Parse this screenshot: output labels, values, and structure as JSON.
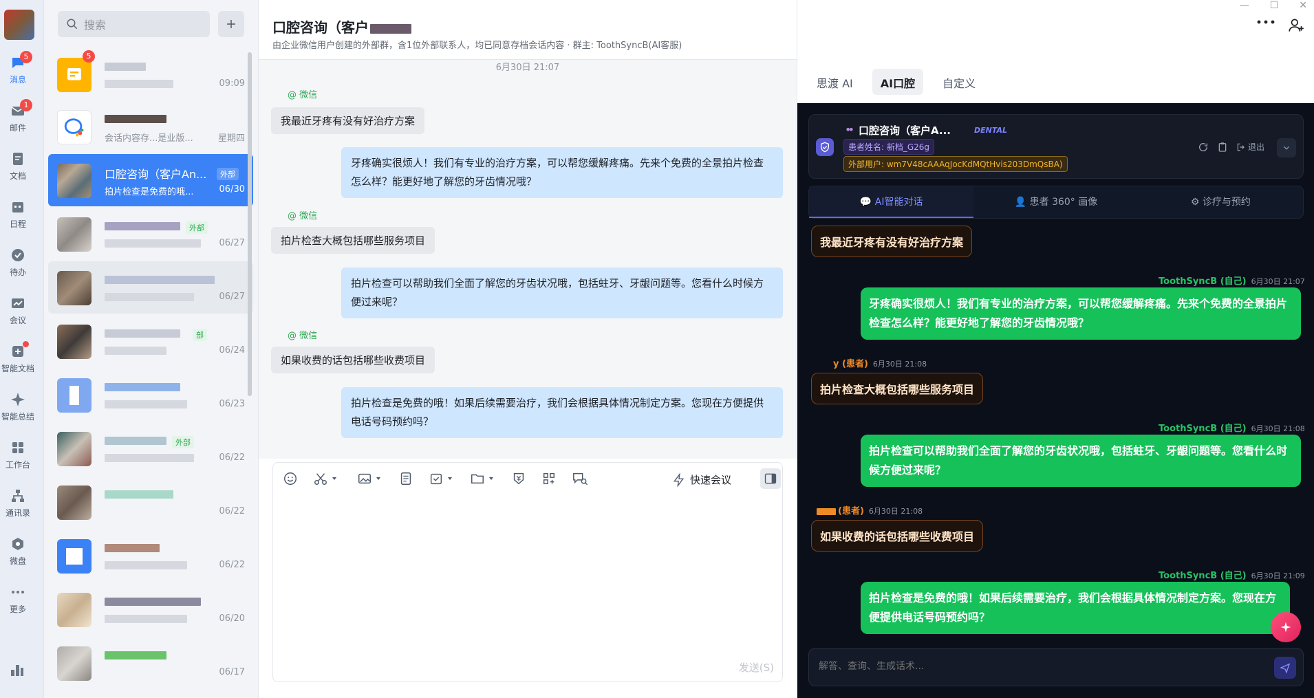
{
  "nav": {
    "items": [
      {
        "label": "消息",
        "icon": "chat-bubble-icon",
        "badge": "5"
      },
      {
        "label": "邮件",
        "icon": "mail-icon",
        "badge": "1"
      },
      {
        "label": "文档",
        "icon": "document-icon"
      },
      {
        "label": "日程",
        "icon": "calendar-icon"
      },
      {
        "label": "待办",
        "icon": "checkmark-icon"
      },
      {
        "label": "会议",
        "icon": "meeting-icon"
      },
      {
        "label": "智能文档",
        "icon": "smart-doc-icon",
        "dot": true
      },
      {
        "label": "智能总结",
        "icon": "sparkle-icon"
      },
      {
        "label": "工作台",
        "icon": "grid-icon"
      },
      {
        "label": "通讯录",
        "icon": "org-chart-icon"
      },
      {
        "label": "微盘",
        "icon": "cloud-drive-icon"
      },
      {
        "label": "更多",
        "icon": "more-dots-icon"
      }
    ]
  },
  "list": {
    "search_placeholder": "搜索",
    "chats": [
      {
        "name": "",
        "preview": "",
        "time": "09:09",
        "badge": "5"
      },
      {
        "name": "",
        "preview": "会话内容存...是业版...",
        "time": "星期四"
      },
      {
        "name": "口腔咨询（客户An...",
        "preview": "拍片检查是免费的哦...",
        "time": "06/30",
        "tag": "外部",
        "active": true
      },
      {
        "name": "",
        "preview": "",
        "time": "06/27",
        "tag": "外部"
      },
      {
        "name": "",
        "preview": "",
        "time": "06/27"
      },
      {
        "name": "",
        "preview": "",
        "time": "06/24",
        "tag": "部"
      },
      {
        "name": "",
        "preview": "",
        "time": "06/23"
      },
      {
        "name": "",
        "preview": "",
        "time": "06/22",
        "tag": "外部"
      },
      {
        "name": "",
        "preview": "",
        "time": "06/22"
      },
      {
        "name": "",
        "preview": "",
        "time": "06/22"
      },
      {
        "name": "",
        "preview": "",
        "time": "06/20"
      },
      {
        "name": "",
        "preview": "",
        "time": "06/17"
      }
    ]
  },
  "chat": {
    "title": "口腔咨询（客户",
    "subtitle": "由企业微信用户创建的外部群，含1位外部联系人，均已同意存档会话内容  · 群主: ToothSyncB(AI客服)",
    "date_stamp": "6月30日 21:07",
    "sender_label": "@ 微信",
    "messages": [
      {
        "dir": "in",
        "text": "我最近牙疼有没有好治疗方案"
      },
      {
        "dir": "out",
        "text": "牙疼确实很烦人！我们有专业的治疗方案，可以帮您缓解疼痛。先来个免费的全景拍片检查怎么样？能更好地了解您的牙齿情况哦？"
      },
      {
        "dir": "in",
        "text": "拍片检查大概包括哪些服务项目"
      },
      {
        "dir": "out",
        "text": "拍片检查可以帮助我们全面了解您的牙齿状况哦，包括蛀牙、牙龈问题等。您看什么时候方便过来呢？"
      },
      {
        "dir": "in",
        "text": "如果收费的话包括哪些收费项目"
      },
      {
        "dir": "out",
        "text": "拍片检查是免费的哦！如果后续需要治疗，我们会根据具体情况制定方案。您现在方便提供电话号码预约吗？"
      }
    ],
    "quick_meeting": "快速会议",
    "send_label": "发送(S)"
  },
  "panel": {
    "tabs": [
      "思渡 AI",
      "AI口腔",
      "自定义"
    ],
    "active_tab": "AI口腔",
    "card": {
      "title": "口腔咨询（客户A...",
      "badge": "DENTAL",
      "patient_name": "患者姓名: 新档_G26g",
      "external_id": "外部用户: wm7V48cAAAqJocKdMQtHvis203DmQsBA)",
      "logout": "退出"
    },
    "subtabs": [
      "AI智能对话",
      "患者 360° 画像",
      "诊疗与预约"
    ],
    "thread": [
      {
        "role": "patient",
        "text": "我最近牙疼有没有好治疗方案"
      },
      {
        "role": "staff",
        "who": "ToothSyncB (自己)",
        "time": "6月30日 21:07",
        "text": "牙疼确实很烦人！我们有专业的治疗方案，可以帮您缓解疼痛。先来个免费的全景拍片检查怎么样？能更好地了解您的牙齿情况哦？"
      },
      {
        "role": "patient",
        "who": "y (患者)",
        "time": "6月30日 21:08",
        "text": "拍片检查大概包括哪些服务项目"
      },
      {
        "role": "staff",
        "who": "ToothSyncB (自己)",
        "time": "6月30日 21:08",
        "text": "拍片检查可以帮助我们全面了解您的牙齿状况哦，包括蛀牙、牙龈问题等。您看什么时候方便过来呢？"
      },
      {
        "role": "patient",
        "who": "(患者)",
        "time": "6月30日 21:08",
        "text": "如果收费的话包括哪些收费项目"
      },
      {
        "role": "staff",
        "who": "ToothSyncB (自己)",
        "time": "6月30日 21:09",
        "text": "拍片检查是免费的哦！如果后续需要治疗，我们会根据具体情况制定方案。您现在方便提供电话号码预约吗？"
      }
    ],
    "input_placeholder": "解答、查询、生成话术..."
  },
  "colors": {
    "accent": "#3b82f6",
    "staff_bubble": "#16c15a",
    "patient_bubble_border": "#7a4520",
    "ai_bg": "#0b0f1a"
  }
}
